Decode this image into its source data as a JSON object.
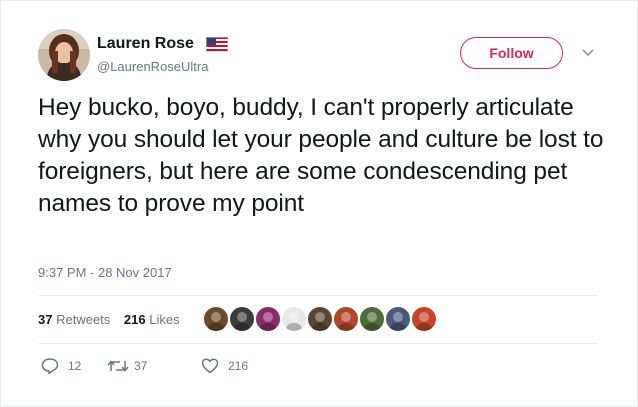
{
  "author": {
    "name": "Lauren Rose",
    "handle": "@LaurenRoseUltra",
    "avatar_icon": "profile-photo",
    "flag_icon": "us-flag-icon"
  },
  "follow_label": "Follow",
  "tweet": {
    "text": "Hey bucko, boyo, buddy, I can't properly articulate why you should let your people and culture be lost to foreigners, but here are some condescending pet names to prove my point",
    "timestamp": "9:37 PM - 28 Nov 2017"
  },
  "stats": {
    "retweets_count": "37",
    "retweets_label": "Retweets",
    "likes_count": "216",
    "likes_label": "Likes"
  },
  "likers": [
    {
      "icon": "liker-avatar",
      "color": "#6b4a2a"
    },
    {
      "icon": "liker-avatar",
      "color": "#3c3c3c"
    },
    {
      "icon": "liker-avatar",
      "color": "#8a2b6a"
    },
    {
      "icon": "liker-avatar",
      "color": "#e8e8e8"
    },
    {
      "icon": "liker-avatar",
      "color": "#5a4632"
    },
    {
      "icon": "liker-avatar",
      "color": "#b0472a"
    },
    {
      "icon": "liker-avatar",
      "color": "#4f6b3a"
    },
    {
      "icon": "liker-avatar",
      "color": "#4a5a7a"
    },
    {
      "icon": "liker-avatar",
      "color": "#c4462a"
    }
  ],
  "actions": {
    "replies": "12",
    "retweets": "37",
    "likes": "216"
  },
  "colors": {
    "follow_accent": "#e0245e",
    "secondary_text": "#657786",
    "primary_text": "#14171a"
  }
}
